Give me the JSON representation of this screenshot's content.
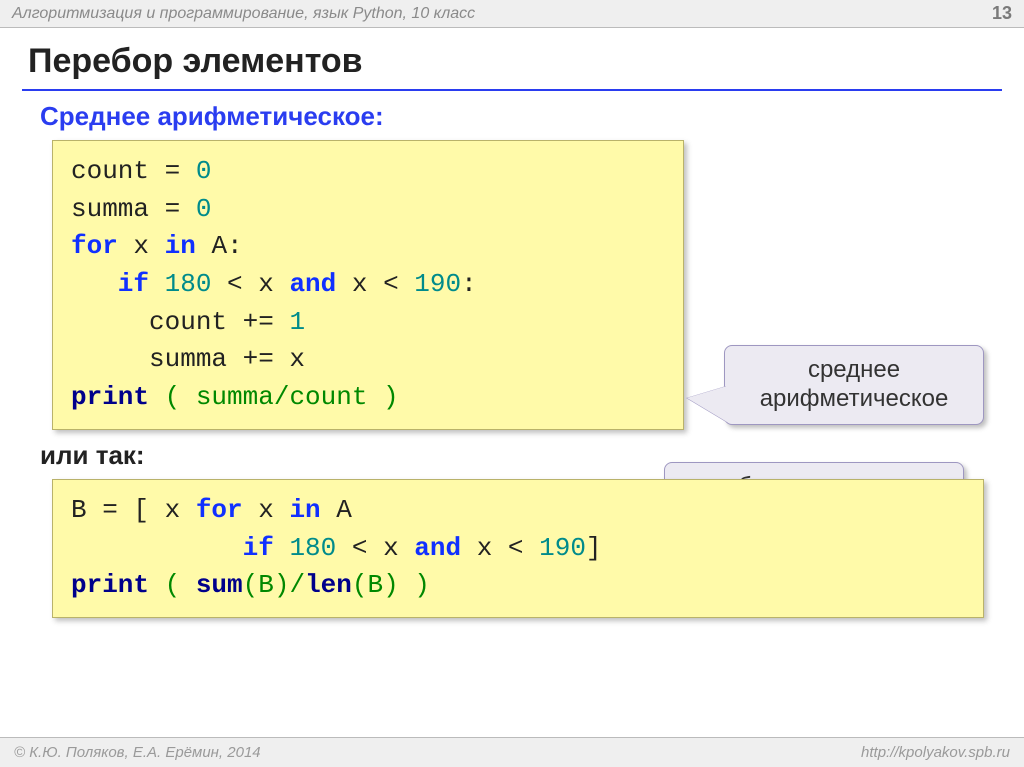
{
  "topbar": {
    "course": "Алгоритмизация и программирование, язык Python, 10 класс",
    "page": "13"
  },
  "heading": "Перебор элементов",
  "section1": {
    "title": "Среднее арифметическое:"
  },
  "code1": {
    "l1a": "count",
    "l1b": " = ",
    "l1c": "0",
    "l2a": "summa",
    "l2b": " = ",
    "l2c": "0",
    "l3a": "for",
    "l3b": " x ",
    "l3c": "in",
    "l3d": " A:",
    "l4a": "   if",
    "l4b": " ",
    "l4c": "180",
    "l4d": " < x ",
    "l4e": "and",
    "l4f": " x < ",
    "l4g": "190",
    "l4h": ":",
    "l5a": "     count += ",
    "l5b": "1",
    "l6": "     summa += x",
    "l7a": "print",
    "l7b": " ( summa/count )"
  },
  "callout1": {
    "line1": "среднее",
    "line2": "арифметическое"
  },
  "section2": {
    "title": "или так:"
  },
  "callout2": {
    "text": "отбираем нужные"
  },
  "code2": {
    "l1a": "B = [ x ",
    "l1b": "for",
    "l1c": " x ",
    "l1d": "in",
    "l1e": " A ",
    "l2a": "           if",
    "l2b": " ",
    "l2c": "180",
    "l2d": " < x ",
    "l2e": "and",
    "l2f": " x < ",
    "l2g": "190",
    "l2h": "]",
    "l3a": "print",
    "l3b": " ( ",
    "l3c": "sum",
    "l3d": "(B)/",
    "l3e": "len",
    "l3f": "(B) )"
  },
  "footer": {
    "left": "© К.Ю. Поляков, Е.А. Ерёмин, 2014",
    "right": "http://kpolyakov.spb.ru"
  }
}
